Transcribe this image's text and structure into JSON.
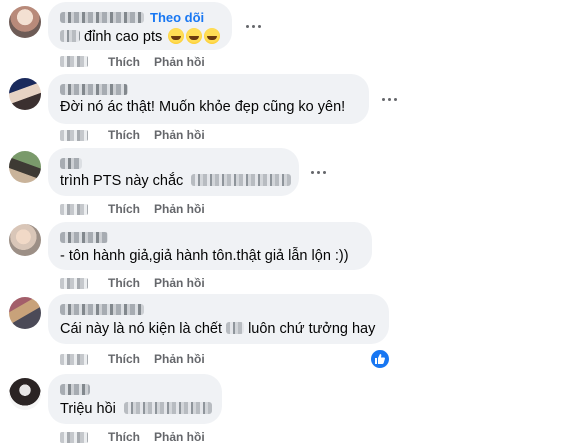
{
  "comments": [
    {
      "text": "đỉnh cao pts",
      "follow_label": "Theo dõi",
      "emoji": [
        "laughing-face-icon",
        "laughing-face-icon",
        "laughing-face-icon"
      ],
      "like": "Thích",
      "reply": "Phản hồi"
    },
    {
      "text": "Đời nó ác thật! Muốn khỏe đẹp cũng ko yên!",
      "like": "Thích",
      "reply": "Phản hồi"
    },
    {
      "text": "trình PTS này chắc",
      "like": "Thích",
      "reply": "Phản hồi"
    },
    {
      "text": "- tôn hành giả,giả hành tôn.thật giả lẫn lộn :))",
      "like": "Thích",
      "reply": "Phản hồi"
    },
    {
      "text_before": "Cái này là nó kiện là chết",
      "text_after": "luôn chứ tưởng hay",
      "like": "Thích",
      "reply": "Phản hồi",
      "reaction": "like-icon"
    },
    {
      "text": "Triệu hồi",
      "like": "Thích",
      "reply": "Phản hồi"
    }
  ],
  "colors": {
    "bubble": "#f0f2f5",
    "link": "#1877f2",
    "muted": "#65676b"
  }
}
